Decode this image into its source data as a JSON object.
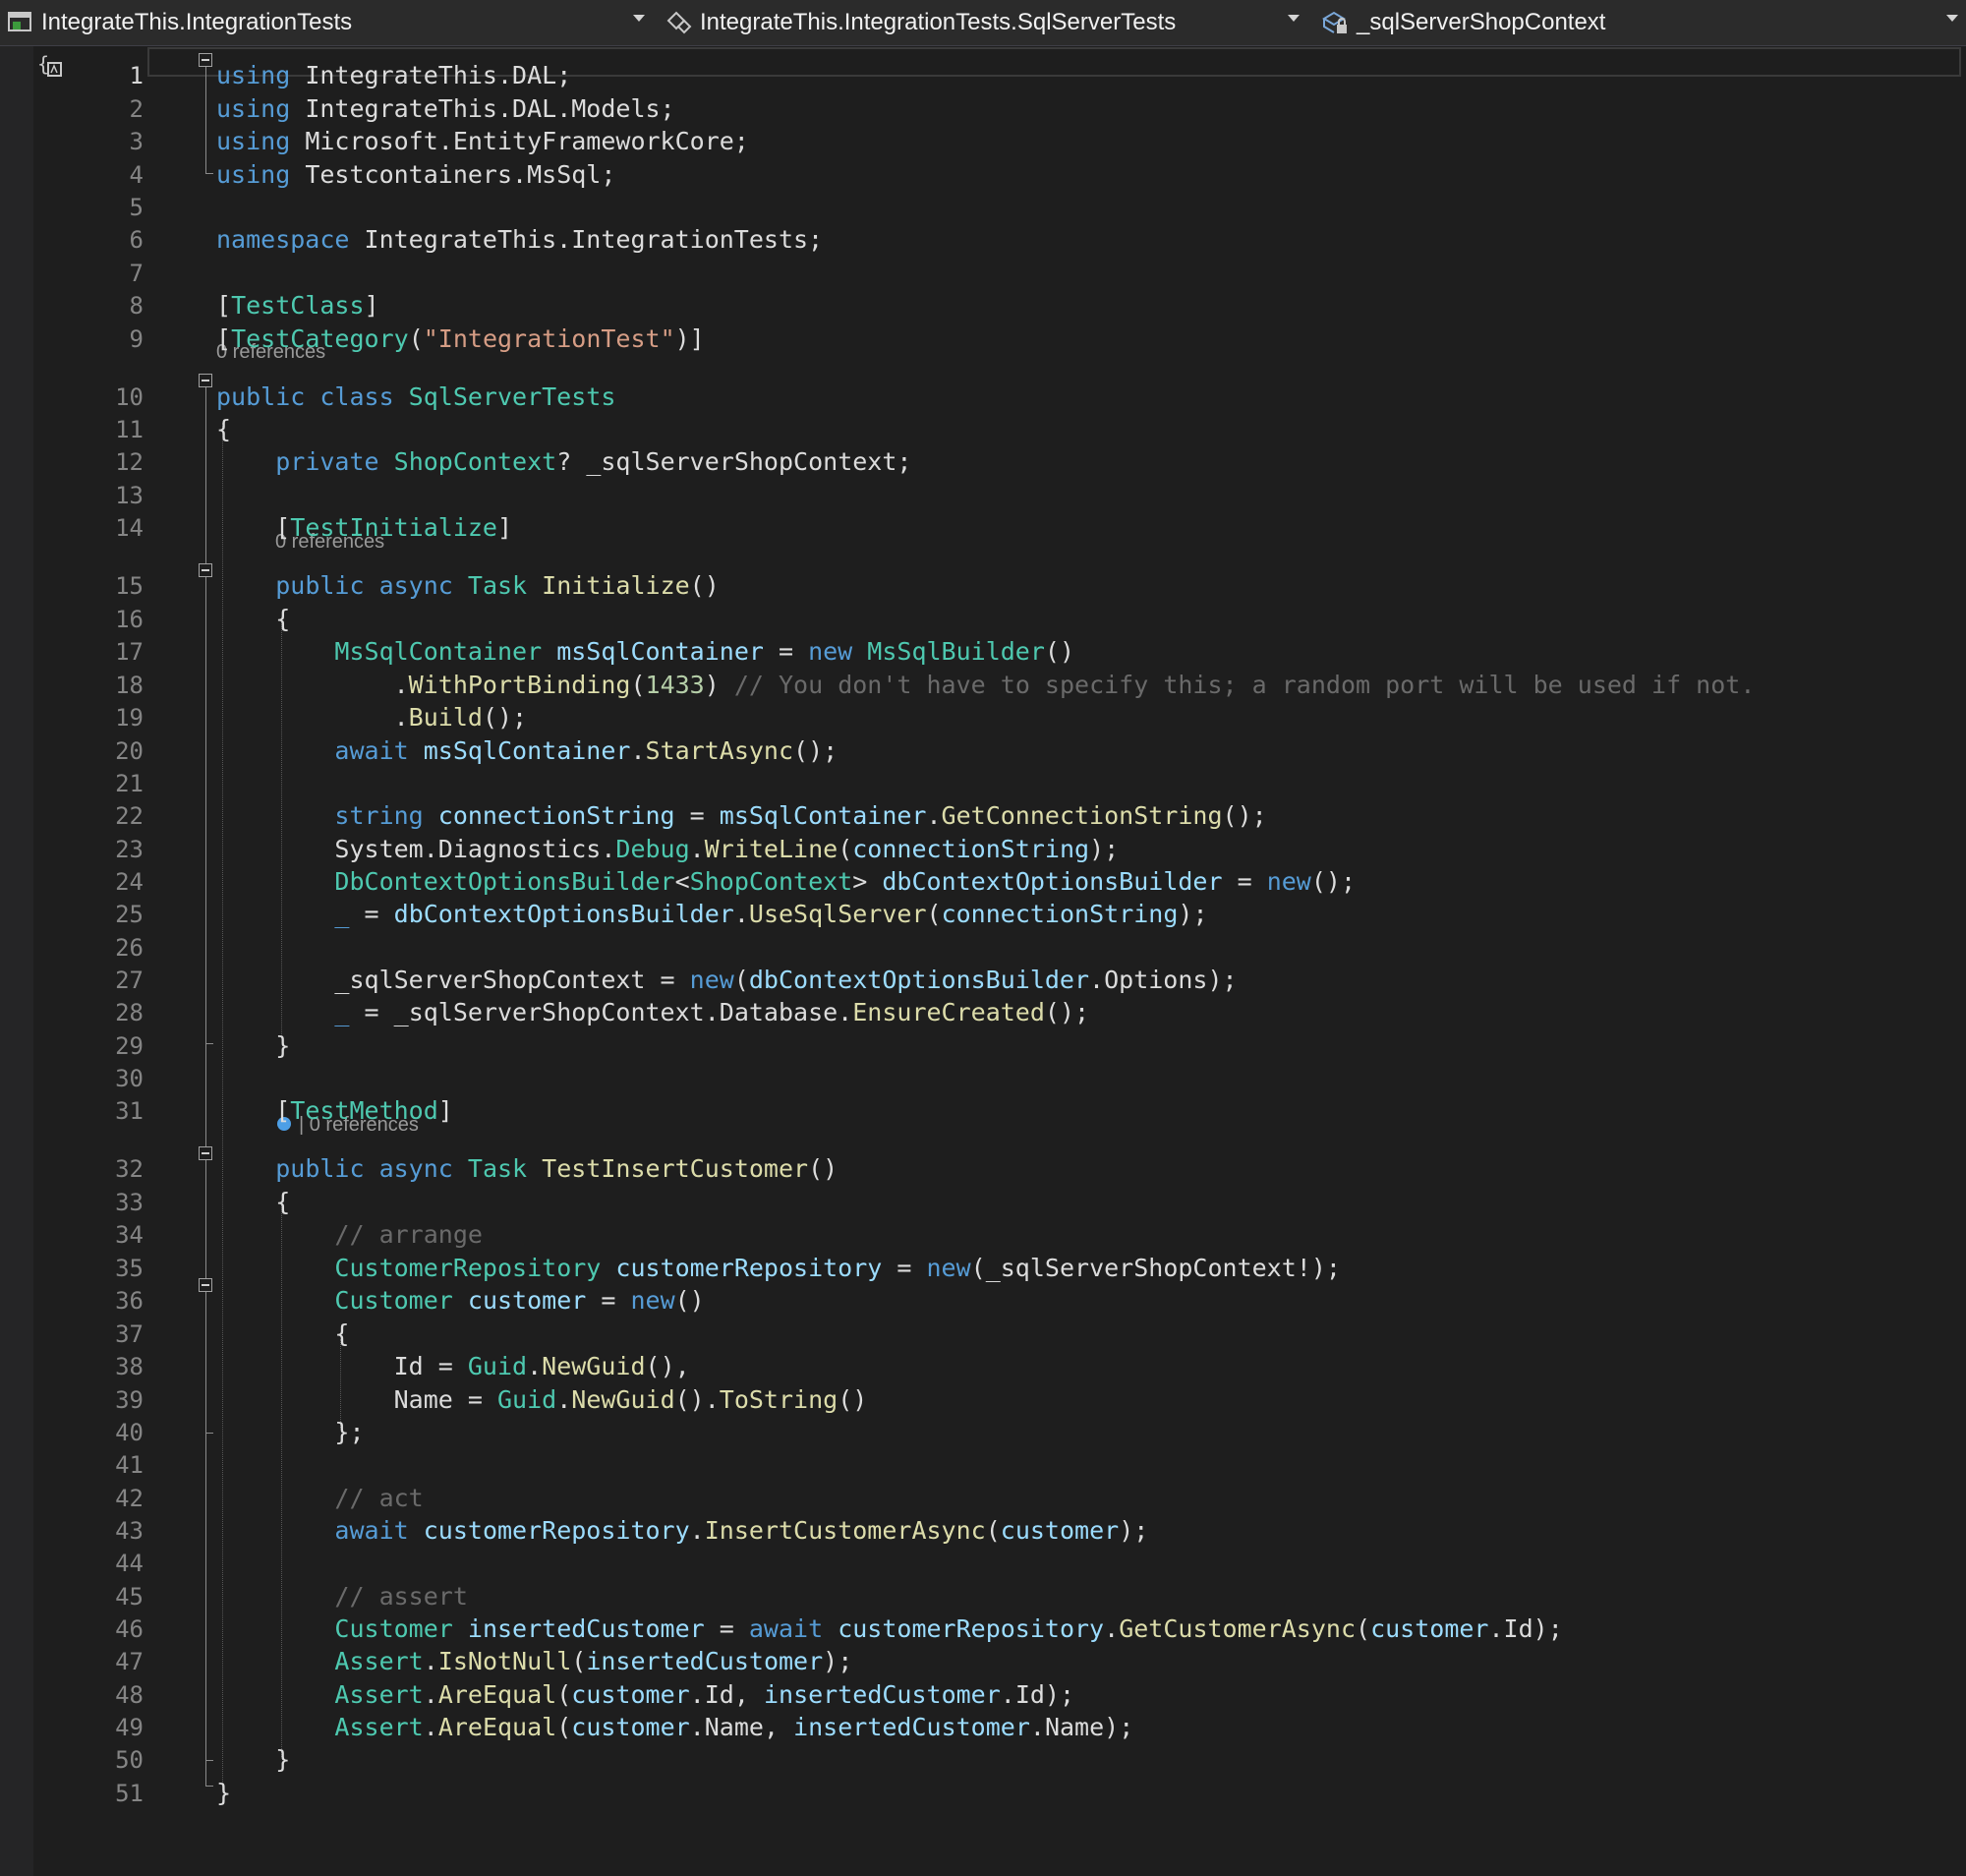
{
  "navbar": {
    "project": "IntegrateThis.IntegrationTests",
    "type": "IntegrateThis.IntegrationTests.SqlServerTests",
    "member": "_sqlServerShopContext"
  },
  "code_lens": {
    "ref_line9": "0 references",
    "ref_line14": "0 references",
    "ref_line31": "| 0 references"
  },
  "lines": [
    {
      "n": "1",
      "tokens": [
        [
          "k",
          "using"
        ],
        [
          "p",
          " IntegrateThis.DAL;"
        ]
      ]
    },
    {
      "n": "2",
      "tokens": [
        [
          "k",
          "using"
        ],
        [
          "p",
          " IntegrateThis.DAL.Models;"
        ]
      ]
    },
    {
      "n": "3",
      "tokens": [
        [
          "k",
          "using"
        ],
        [
          "p",
          " Microsoft.EntityFrameworkCore;"
        ]
      ]
    },
    {
      "n": "4",
      "tokens": [
        [
          "k",
          "using"
        ],
        [
          "p",
          " Testcontainers.MsSql;"
        ]
      ]
    },
    {
      "n": "5",
      "tokens": []
    },
    {
      "n": "6",
      "tokens": [
        [
          "k",
          "namespace"
        ],
        [
          "p",
          " IntegrateThis.IntegrationTests;"
        ]
      ]
    },
    {
      "n": "7",
      "tokens": []
    },
    {
      "n": "8",
      "tokens": [
        [
          "p",
          "["
        ],
        [
          "t",
          "TestClass"
        ],
        [
          "p",
          "]"
        ]
      ]
    },
    {
      "n": "9",
      "tokens": [
        [
          "p",
          "["
        ],
        [
          "t",
          "TestCategory"
        ],
        [
          "p",
          "("
        ],
        [
          "s",
          "\"IntegrationTest\""
        ],
        [
          "p",
          ")]"
        ]
      ]
    },
    {
      "n": "10",
      "tokens": [
        [
          "k",
          "public class "
        ],
        [
          "t",
          "SqlServerTests"
        ]
      ]
    },
    {
      "n": "11",
      "tokens": [
        [
          "p",
          "{"
        ]
      ]
    },
    {
      "n": "12",
      "tokens": [
        [
          "p",
          "    "
        ],
        [
          "k",
          "private "
        ],
        [
          "t",
          "ShopContext"
        ],
        [
          "p",
          "? _sqlServerShopContext;"
        ]
      ]
    },
    {
      "n": "13",
      "tokens": []
    },
    {
      "n": "14",
      "tokens": [
        [
          "p",
          "    ["
        ],
        [
          "t",
          "TestInitialize"
        ],
        [
          "p",
          "]"
        ]
      ]
    },
    {
      "n": "15",
      "tokens": [
        [
          "p",
          "    "
        ],
        [
          "k",
          "public async "
        ],
        [
          "t",
          "Task "
        ],
        [
          "m",
          "Initialize"
        ],
        [
          "p",
          "()"
        ]
      ]
    },
    {
      "n": "16",
      "tokens": [
        [
          "p",
          "    {"
        ]
      ]
    },
    {
      "n": "17",
      "tokens": [
        [
          "p",
          "        "
        ],
        [
          "t",
          "MsSqlContainer "
        ],
        [
          "v",
          "msSqlContainer"
        ],
        [
          "p",
          " = "
        ],
        [
          "k",
          "new "
        ],
        [
          "t",
          "MsSqlBuilder"
        ],
        [
          "p",
          "()"
        ]
      ]
    },
    {
      "n": "18",
      "tokens": [
        [
          "p",
          "            ."
        ],
        [
          "m",
          "WithPortBinding"
        ],
        [
          "p",
          "("
        ],
        [
          "n",
          "1433"
        ],
        [
          "p",
          ") "
        ],
        [
          "cm",
          "// You don't have to specify this; a random port will be used if not."
        ]
      ]
    },
    {
      "n": "19",
      "tokens": [
        [
          "p",
          "            ."
        ],
        [
          "m",
          "Build"
        ],
        [
          "p",
          "();"
        ]
      ]
    },
    {
      "n": "20",
      "tokens": [
        [
          "p",
          "        "
        ],
        [
          "k",
          "await "
        ],
        [
          "v",
          "msSqlContainer"
        ],
        [
          "p",
          "."
        ],
        [
          "m",
          "StartAsync"
        ],
        [
          "p",
          "();"
        ]
      ]
    },
    {
      "n": "21",
      "tokens": []
    },
    {
      "n": "22",
      "tokens": [
        [
          "p",
          "        "
        ],
        [
          "k",
          "string "
        ],
        [
          "v",
          "connectionString"
        ],
        [
          "p",
          " = "
        ],
        [
          "v",
          "msSqlContainer"
        ],
        [
          "p",
          "."
        ],
        [
          "m",
          "GetConnectionString"
        ],
        [
          "p",
          "();"
        ]
      ]
    },
    {
      "n": "23",
      "tokens": [
        [
          "p",
          "        System.Diagnostics."
        ],
        [
          "t",
          "Debug"
        ],
        [
          "p",
          "."
        ],
        [
          "m",
          "WriteLine"
        ],
        [
          "p",
          "("
        ],
        [
          "v",
          "connectionString"
        ],
        [
          "p",
          ");"
        ]
      ]
    },
    {
      "n": "24",
      "tokens": [
        [
          "p",
          "        "
        ],
        [
          "t",
          "DbContextOptionsBuilder"
        ],
        [
          "p",
          "<"
        ],
        [
          "t",
          "ShopContext"
        ],
        [
          "p",
          "> "
        ],
        [
          "v",
          "dbContextOptionsBuilder"
        ],
        [
          "p",
          " = "
        ],
        [
          "k",
          "new"
        ],
        [
          "p",
          "();"
        ]
      ]
    },
    {
      "n": "25",
      "tokens": [
        [
          "p",
          "        "
        ],
        [
          "k",
          "_"
        ],
        [
          "p",
          " = "
        ],
        [
          "v",
          "dbContextOptionsBuilder"
        ],
        [
          "p",
          "."
        ],
        [
          "m",
          "UseSqlServer"
        ],
        [
          "p",
          "("
        ],
        [
          "v",
          "connectionString"
        ],
        [
          "p",
          ");"
        ]
      ]
    },
    {
      "n": "26",
      "tokens": []
    },
    {
      "n": "27",
      "tokens": [
        [
          "p",
          "        _sqlServerShopContext = "
        ],
        [
          "k",
          "new"
        ],
        [
          "p",
          "("
        ],
        [
          "v",
          "dbContextOptionsBuilder"
        ],
        [
          "p",
          ".Options);"
        ]
      ]
    },
    {
      "n": "28",
      "tokens": [
        [
          "p",
          "        "
        ],
        [
          "k",
          "_"
        ],
        [
          "p",
          " = _sqlServerShopContext.Database."
        ],
        [
          "m",
          "EnsureCreated"
        ],
        [
          "p",
          "();"
        ]
      ]
    },
    {
      "n": "29",
      "tokens": [
        [
          "p",
          "    }"
        ]
      ]
    },
    {
      "n": "30",
      "tokens": []
    },
    {
      "n": "31",
      "tokens": [
        [
          "p",
          "    ["
        ],
        [
          "t",
          "TestMethod"
        ],
        [
          "p",
          "]"
        ]
      ]
    },
    {
      "n": "32",
      "tokens": [
        [
          "p",
          "    "
        ],
        [
          "k",
          "public async "
        ],
        [
          "t",
          "Task "
        ],
        [
          "m",
          "TestInsertCustomer"
        ],
        [
          "p",
          "()"
        ]
      ]
    },
    {
      "n": "33",
      "tokens": [
        [
          "p",
          "    {"
        ]
      ]
    },
    {
      "n": "34",
      "tokens": [
        [
          "p",
          "        "
        ],
        [
          "cm",
          "// arrange"
        ]
      ]
    },
    {
      "n": "35",
      "tokens": [
        [
          "p",
          "        "
        ],
        [
          "t",
          "CustomerRepository "
        ],
        [
          "v",
          "customerRepository"
        ],
        [
          "p",
          " = "
        ],
        [
          "k",
          "new"
        ],
        [
          "p",
          "(_sqlServerShopContext!);"
        ]
      ]
    },
    {
      "n": "36",
      "tokens": [
        [
          "p",
          "        "
        ],
        [
          "t",
          "Customer "
        ],
        [
          "v",
          "customer"
        ],
        [
          "p",
          " = "
        ],
        [
          "k",
          "new"
        ],
        [
          "p",
          "()"
        ]
      ]
    },
    {
      "n": "37",
      "tokens": [
        [
          "p",
          "        {"
        ]
      ]
    },
    {
      "n": "38",
      "tokens": [
        [
          "p",
          "            Id = "
        ],
        [
          "t",
          "Guid"
        ],
        [
          "p",
          "."
        ],
        [
          "m",
          "NewGuid"
        ],
        [
          "p",
          "(),"
        ]
      ]
    },
    {
      "n": "39",
      "tokens": [
        [
          "p",
          "            Name = "
        ],
        [
          "t",
          "Guid"
        ],
        [
          "p",
          "."
        ],
        [
          "m",
          "NewGuid"
        ],
        [
          "p",
          "()."
        ],
        [
          "m",
          "ToString"
        ],
        [
          "p",
          "()"
        ]
      ]
    },
    {
      "n": "40",
      "tokens": [
        [
          "p",
          "        };"
        ]
      ]
    },
    {
      "n": "41",
      "tokens": []
    },
    {
      "n": "42",
      "tokens": [
        [
          "p",
          "        "
        ],
        [
          "cm",
          "// act"
        ]
      ]
    },
    {
      "n": "43",
      "tokens": [
        [
          "p",
          "        "
        ],
        [
          "k",
          "await "
        ],
        [
          "v",
          "customerRepository"
        ],
        [
          "p",
          "."
        ],
        [
          "m",
          "InsertCustomerAsync"
        ],
        [
          "p",
          "("
        ],
        [
          "v",
          "customer"
        ],
        [
          "p",
          ");"
        ]
      ]
    },
    {
      "n": "44",
      "tokens": []
    },
    {
      "n": "45",
      "tokens": [
        [
          "p",
          "        "
        ],
        [
          "cm",
          "// assert"
        ]
      ]
    },
    {
      "n": "46",
      "tokens": [
        [
          "p",
          "        "
        ],
        [
          "t",
          "Customer "
        ],
        [
          "v",
          "insertedCustomer"
        ],
        [
          "p",
          " = "
        ],
        [
          "k",
          "await "
        ],
        [
          "v",
          "customerRepository"
        ],
        [
          "p",
          "."
        ],
        [
          "m",
          "GetCustomerAsync"
        ],
        [
          "p",
          "("
        ],
        [
          "v",
          "customer"
        ],
        [
          "p",
          ".Id);"
        ]
      ]
    },
    {
      "n": "47",
      "tokens": [
        [
          "p",
          "        "
        ],
        [
          "t",
          "Assert"
        ],
        [
          "p",
          "."
        ],
        [
          "m",
          "IsNotNull"
        ],
        [
          "p",
          "("
        ],
        [
          "v",
          "insertedCustomer"
        ],
        [
          "p",
          ");"
        ]
      ]
    },
    {
      "n": "48",
      "tokens": [
        [
          "p",
          "        "
        ],
        [
          "t",
          "Assert"
        ],
        [
          "p",
          "."
        ],
        [
          "m",
          "AreEqual"
        ],
        [
          "p",
          "("
        ],
        [
          "v",
          "customer"
        ],
        [
          "p",
          ".Id, "
        ],
        [
          "v",
          "insertedCustomer"
        ],
        [
          "p",
          ".Id);"
        ]
      ]
    },
    {
      "n": "49",
      "tokens": [
        [
          "p",
          "        "
        ],
        [
          "t",
          "Assert"
        ],
        [
          "p",
          "."
        ],
        [
          "m",
          "AreEqual"
        ],
        [
          "p",
          "("
        ],
        [
          "v",
          "customer"
        ],
        [
          "p",
          ".Name, "
        ],
        [
          "v",
          "insertedCustomer"
        ],
        [
          "p",
          ".Name);"
        ]
      ]
    },
    {
      "n": "50",
      "tokens": [
        [
          "p",
          "    }"
        ]
      ]
    },
    {
      "n": "51",
      "tokens": [
        [
          "p",
          "}"
        ]
      ]
    }
  ],
  "theme": {
    "background": "#1e1e1e",
    "keyword": "#569cd6",
    "type": "#4ec9b0",
    "method": "#dcdcaa",
    "variable": "#9cdcfe",
    "string": "#d69d85",
    "comment": "#6a6a6a",
    "line_number": "#858585"
  }
}
